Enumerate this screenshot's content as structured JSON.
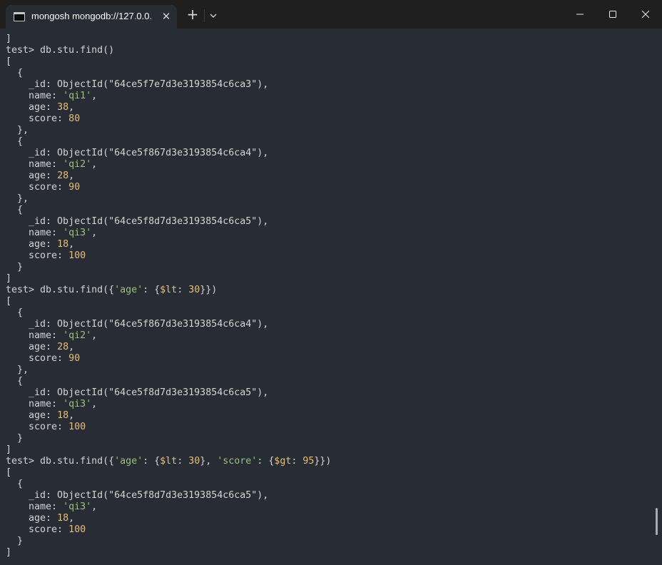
{
  "window": {
    "tab_title": "mongosh mongodb://127.0.0.",
    "tab_close": "✕",
    "new_tab": "+"
  },
  "colors": {
    "background": "#282c34",
    "titlebar": "#1f1f1f",
    "text": "#d4d4d4",
    "number": "#e5c07b",
    "string": "#98c379"
  },
  "terminal": {
    "lines": [
      [
        {
          "t": "]"
        }
      ],
      [
        {
          "t": "test> db.stu.find()"
        }
      ],
      [
        {
          "t": "["
        }
      ],
      [
        {
          "t": "  {"
        }
      ],
      [
        {
          "t": "    _id: ObjectId(\"64ce5f7e7d3e3193854c6ca3\"),"
        }
      ],
      [
        {
          "t": "    name: "
        },
        {
          "t": "'qi1'",
          "c": "g"
        },
        {
          "t": ","
        }
      ],
      [
        {
          "t": "    age: "
        },
        {
          "t": "38",
          "c": "y"
        },
        {
          "t": ","
        }
      ],
      [
        {
          "t": "    score: "
        },
        {
          "t": "80",
          "c": "y"
        }
      ],
      [
        {
          "t": "  },"
        }
      ],
      [
        {
          "t": "  {"
        }
      ],
      [
        {
          "t": "    _id: ObjectId(\"64ce5f867d3e3193854c6ca4\"),"
        }
      ],
      [
        {
          "t": "    name: "
        },
        {
          "t": "'qi2'",
          "c": "g"
        },
        {
          "t": ","
        }
      ],
      [
        {
          "t": "    age: "
        },
        {
          "t": "28",
          "c": "y"
        },
        {
          "t": ","
        }
      ],
      [
        {
          "t": "    score: "
        },
        {
          "t": "90",
          "c": "y"
        }
      ],
      [
        {
          "t": "  },"
        }
      ],
      [
        {
          "t": "  {"
        }
      ],
      [
        {
          "t": "    _id: ObjectId(\"64ce5f8d7d3e3193854c6ca5\"),"
        }
      ],
      [
        {
          "t": "    name: "
        },
        {
          "t": "'qi3'",
          "c": "g"
        },
        {
          "t": ","
        }
      ],
      [
        {
          "t": "    age: "
        },
        {
          "t": "18",
          "c": "y"
        },
        {
          "t": ","
        }
      ],
      [
        {
          "t": "    score: "
        },
        {
          "t": "100",
          "c": "y"
        }
      ],
      [
        {
          "t": "  }"
        }
      ],
      [
        {
          "t": "]"
        }
      ],
      [
        {
          "t": "test> db.stu.find({"
        },
        {
          "t": "'age'",
          "c": "g"
        },
        {
          "t": ": {"
        },
        {
          "t": "$lt",
          "c": "y"
        },
        {
          "t": ": "
        },
        {
          "t": "30",
          "c": "y"
        },
        {
          "t": "}})"
        }
      ],
      [
        {
          "t": "["
        }
      ],
      [
        {
          "t": "  {"
        }
      ],
      [
        {
          "t": "    _id: ObjectId(\"64ce5f867d3e3193854c6ca4\"),"
        }
      ],
      [
        {
          "t": "    name: "
        },
        {
          "t": "'qi2'",
          "c": "g"
        },
        {
          "t": ","
        }
      ],
      [
        {
          "t": "    age: "
        },
        {
          "t": "28",
          "c": "y"
        },
        {
          "t": ","
        }
      ],
      [
        {
          "t": "    score: "
        },
        {
          "t": "90",
          "c": "y"
        }
      ],
      [
        {
          "t": "  },"
        }
      ],
      [
        {
          "t": "  {"
        }
      ],
      [
        {
          "t": "    _id: ObjectId(\"64ce5f8d7d3e3193854c6ca5\"),"
        }
      ],
      [
        {
          "t": "    name: "
        },
        {
          "t": "'qi3'",
          "c": "g"
        },
        {
          "t": ","
        }
      ],
      [
        {
          "t": "    age: "
        },
        {
          "t": "18",
          "c": "y"
        },
        {
          "t": ","
        }
      ],
      [
        {
          "t": "    score: "
        },
        {
          "t": "100",
          "c": "y"
        }
      ],
      [
        {
          "t": "  }"
        }
      ],
      [
        {
          "t": "]"
        }
      ],
      [
        {
          "t": "test> db.stu.find({"
        },
        {
          "t": "'age'",
          "c": "g"
        },
        {
          "t": ": {"
        },
        {
          "t": "$lt",
          "c": "y"
        },
        {
          "t": ": "
        },
        {
          "t": "30",
          "c": "y"
        },
        {
          "t": "}, "
        },
        {
          "t": "'score'",
          "c": "g"
        },
        {
          "t": ": {"
        },
        {
          "t": "$gt",
          "c": "y"
        },
        {
          "t": ": "
        },
        {
          "t": "95",
          "c": "y"
        },
        {
          "t": "}})"
        }
      ],
      [
        {
          "t": "["
        }
      ],
      [
        {
          "t": "  {"
        }
      ],
      [
        {
          "t": "    _id: ObjectId(\"64ce5f8d7d3e3193854c6ca5\"),"
        }
      ],
      [
        {
          "t": "    name: "
        },
        {
          "t": "'qi3'",
          "c": "g"
        },
        {
          "t": ","
        }
      ],
      [
        {
          "t": "    age: "
        },
        {
          "t": "18",
          "c": "y"
        },
        {
          "t": ","
        }
      ],
      [
        {
          "t": "    score: "
        },
        {
          "t": "100",
          "c": "y"
        }
      ],
      [
        {
          "t": "  }"
        }
      ],
      [
        {
          "t": "]"
        }
      ]
    ]
  }
}
